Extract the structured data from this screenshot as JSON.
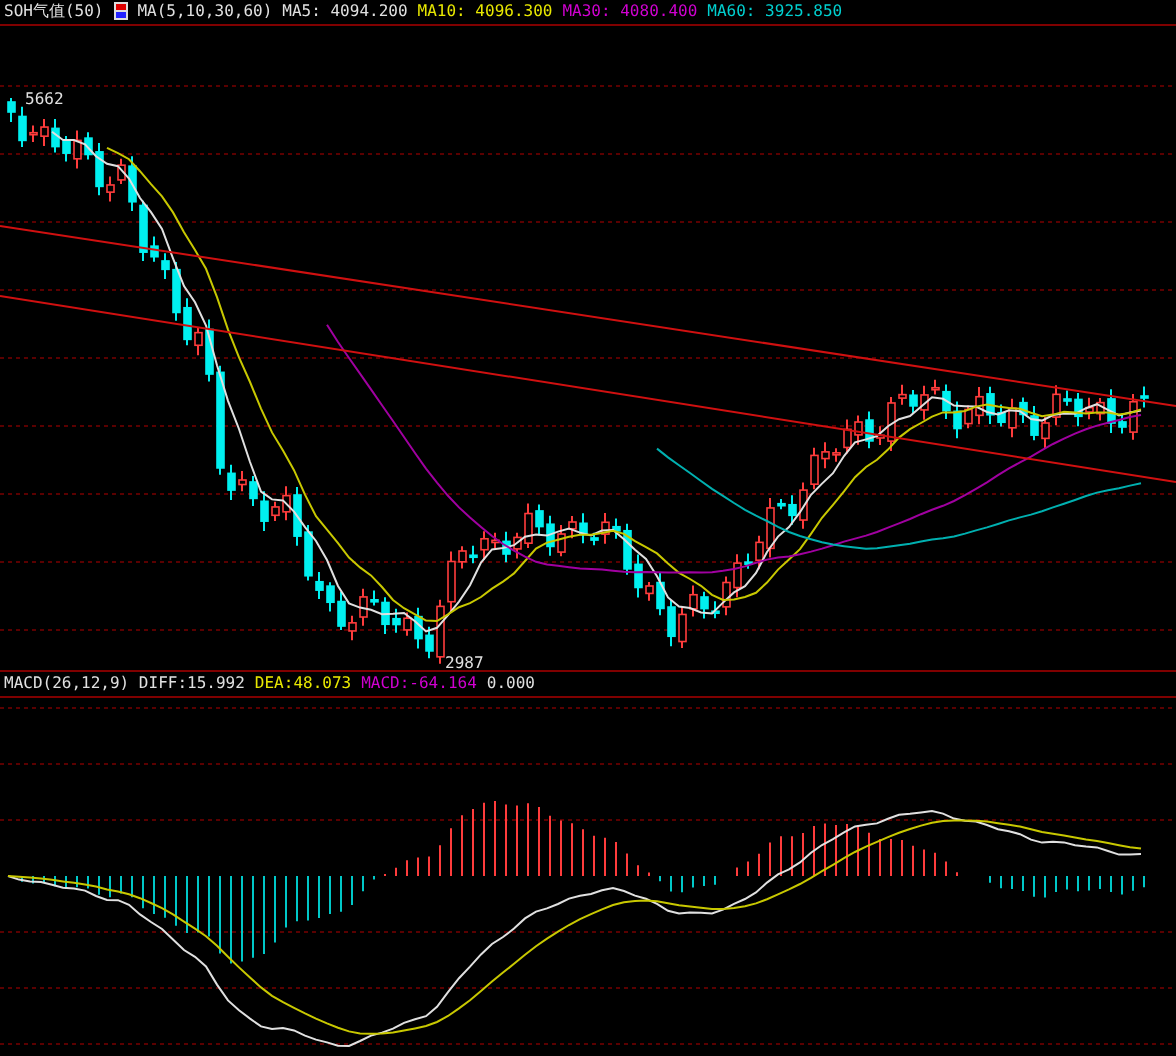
{
  "price_panel": {
    "legend": [
      {
        "text": "SOH气值(50)",
        "color": "#e0e0e0"
      },
      {
        "text": "MA(5,10,30,60)",
        "color": "#e0e0e0"
      },
      {
        "text": "MA5: 4094.200",
        "color": "#e0e0e0"
      },
      {
        "text": "MA10: 4096.300",
        "color": "#e8e800"
      },
      {
        "text": "MA30: 4080.400",
        "color": "#d000d0"
      },
      {
        "text": "MA60: 3925.850",
        "color": "#00d0d0"
      }
    ],
    "high_label": "5662",
    "low_label": "2987"
  },
  "macd_panel": {
    "legend": [
      {
        "text": "MACD(26,12,9) DIFF:15.992",
        "color": "#e0e0e0"
      },
      {
        "text": "DEA:48.073",
        "color": "#e8e800"
      },
      {
        "text": "MACD:-64.164",
        "color": "#d000d0"
      },
      {
        "text": "0.000",
        "color": "#e0e0e0"
      }
    ]
  }
}
